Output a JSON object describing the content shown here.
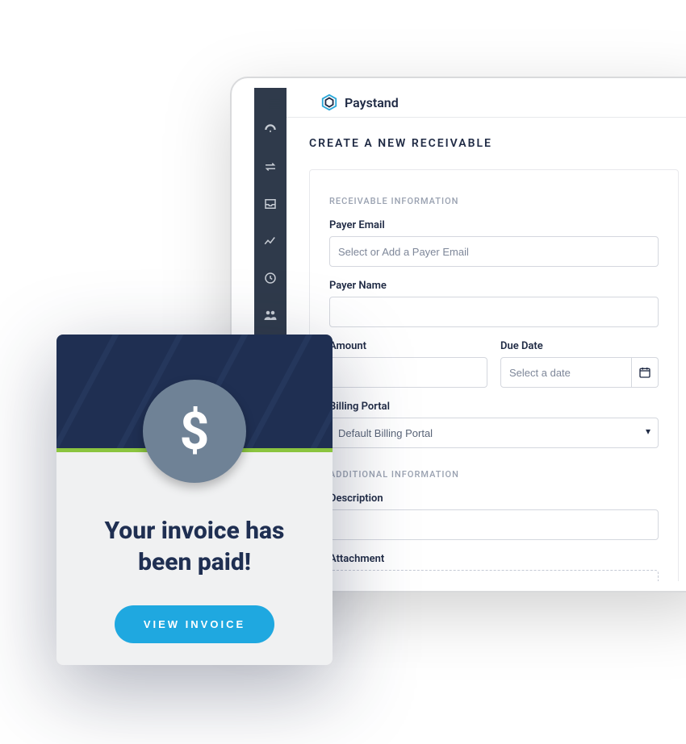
{
  "app": {
    "brand": "Paystand",
    "page_title": "CREATE A NEW RECEIVABLE"
  },
  "sections": {
    "receivable": "RECEIVABLE INFORMATION",
    "additional": "ADDITIONAL INFORMATION"
  },
  "fields": {
    "payer_email": {
      "label": "Payer Email",
      "placeholder": "Select or Add a Payer Email"
    },
    "payer_name": {
      "label": "Payer Name"
    },
    "amount": {
      "label": "Amount"
    },
    "due_date": {
      "label": "Due Date",
      "placeholder": "Select a date"
    },
    "billing_portal": {
      "label": "Billing Portal",
      "value": "Default Billing Portal"
    },
    "description": {
      "label": "Description"
    },
    "attachment": {
      "label": "Attachment"
    }
  },
  "paid_card": {
    "title": "Your invoice has been paid!",
    "button": "VIEW INVOICE"
  }
}
